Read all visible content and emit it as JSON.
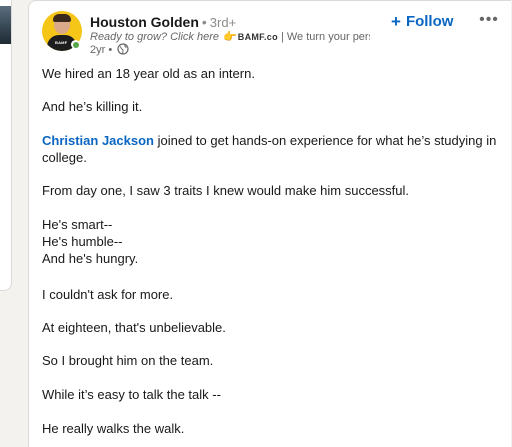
{
  "post": {
    "author": {
      "name": "Houston Golden",
      "separator": "•",
      "degree": "3rd+",
      "tagline_prefix": "Ready to grow? Click here",
      "tagline_brand": "BAMF.co",
      "tagline_suffix": "| We turn your perso...",
      "age": "2yr",
      "meta_separator": "•",
      "avatar_shirt_text": "BAMF"
    },
    "follow_label": "Follow",
    "more_label": "•••",
    "body": {
      "line1": "We hired an 18 year old as an intern.",
      "line2": "And he’s killing it.",
      "mention": "Christian Jackson",
      "line3_rest": " joined to get hands-on experience for what he’s studying in",
      "line3b": "college.",
      "line4": "From day one, I saw 3 traits I knew would make him successful.",
      "line5": "He's smart--",
      "line6": "He's humble--",
      "line7": "And he's hungry.",
      "line8": "I couldn't ask for more.",
      "line9": "At eighteen, that's unbelievable.",
      "line10": "So I brought him on the team.",
      "line11": "While it’s easy to talk the talk --",
      "line12": "He really walks the walk."
    }
  },
  "icons": {
    "plus": "+",
    "pointing": "👉",
    "globe": "globe-icon",
    "more": "more-icon"
  },
  "colors": {
    "link_blue": "#0a66c2",
    "text": "#191919",
    "muted": "#666666",
    "avatar_bg": "#f5c518",
    "online_green": "#57a64a"
  }
}
